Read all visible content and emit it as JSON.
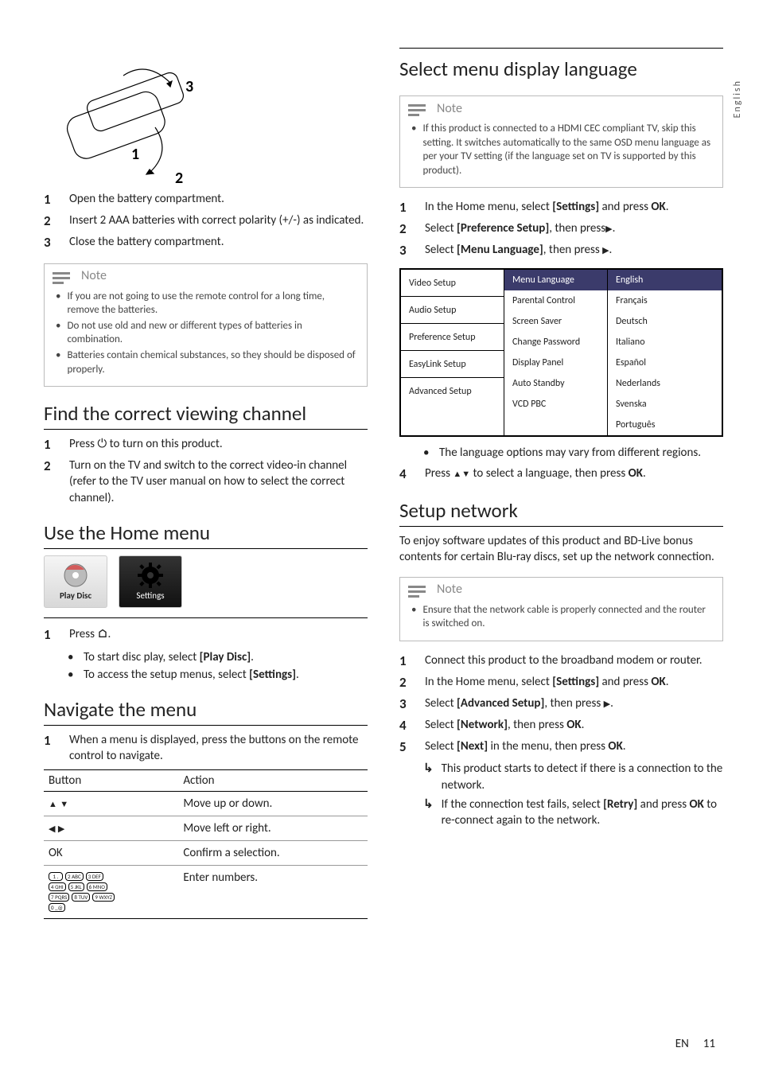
{
  "sideTab": "English",
  "left": {
    "remoteSteps": [
      "Open the battery compartment.",
      "Insert 2 AAA batteries with correct polarity (+/-) as indicated.",
      "Close the battery compartment."
    ],
    "note1Title": "Note",
    "note1Items": [
      "If you are not going to use the remote control for a long time, remove the batteries.",
      "Do not use old and new or different types of batteries in combination.",
      "Batteries contain chemical substances, so they should be disposed of properly."
    ],
    "h_find": "Find the correct viewing channel",
    "findSteps": [
      {
        "pre": "Press ",
        "glyph": "power",
        "post": " to turn on this product."
      },
      {
        "text": "Turn on the TV and switch to the correct video-in channel (refer to the TV user manual on how to select the correct channel)."
      }
    ],
    "h_home": "Use the Home menu",
    "homeIcons": {
      "play": "Play Disc",
      "settings": "Settings"
    },
    "homeStep": {
      "pre": "Press ",
      "glyph": "home",
      "post": "."
    },
    "homeBullets": [
      {
        "pre": "To start disc play, select ",
        "bold": "[Play Disc]",
        "post": "."
      },
      {
        "pre": "To access the setup menus, select ",
        "bold": "[Settings]",
        "post": "."
      }
    ],
    "h_nav": "Navigate the menu",
    "navStep": "When a menu is displayed, press the buttons on the remote control to navigate.",
    "navTable": {
      "hButton": "Button",
      "hAction": "Action",
      "rows": [
        {
          "btn": "updown",
          "action": "Move up or down."
        },
        {
          "btn": "leftright",
          "action": "Move left or right."
        },
        {
          "btn": "OK",
          "action": "Confirm a selection."
        },
        {
          "btn": "keypad",
          "action": "Enter numbers."
        }
      ],
      "keypad": [
        [
          "1 .",
          "2 ABC",
          "3 DEF"
        ],
        [
          "4 GHI",
          "5 JKL",
          "6 MNO"
        ],
        [
          "7 PQRS",
          "8 TUV",
          "9 WXYZ"
        ],
        [
          "0 _@"
        ]
      ]
    }
  },
  "right": {
    "h_lang": "Select menu display language",
    "note2Title": "Note",
    "note2Items": [
      "If this product is connected to a HDMI CEC compliant TV, skip this setting. It switches automatically to the same OSD menu language as per your TV setting (if the language set on TV is supported by this product)."
    ],
    "langSteps": [
      {
        "pre": "In the Home menu, select ",
        "bold": "[Settings]",
        "mid": " and press ",
        "bold2": "OK",
        "post": "."
      },
      {
        "pre": "Select ",
        "bold": "[Preference Setup]",
        "mid": ", then press",
        "arrow": true,
        "post": "."
      },
      {
        "pre": "Select ",
        "bold": "[Menu Language]",
        "mid": ", then press ",
        "arrow": true,
        "post": "."
      }
    ],
    "menu": {
      "left": [
        "Video Setup",
        "Audio Setup",
        "Preference Setup",
        "EasyLink Setup",
        "Advanced Setup"
      ],
      "mid": [
        "Menu Language",
        "Parental Control",
        "Screen Saver",
        "Change Password",
        "Display Panel",
        "Auto Standby",
        "VCD PBC"
      ],
      "right": [
        "English",
        "Français",
        "Deutsch",
        "Italiano",
        "Español",
        "Nederlands",
        "Svenska",
        "Português"
      ]
    },
    "langNote": "The language options may vary from different regions.",
    "langStep4": {
      "num": "4",
      "pre": "Press ",
      "glyph": "updown",
      "mid": " to select a language, then press ",
      "bold": "OK",
      "post": "."
    },
    "h_net": "Setup network",
    "netIntro": "To enjoy software updates of this product and BD-Live bonus contents for certain Blu-ray discs, set up the network connection.",
    "note3Title": "Note",
    "note3Items": [
      "Ensure that the network cable is properly connected and the router is switched on."
    ],
    "netSteps": [
      {
        "text": "Connect this product to the broadband modem or router."
      },
      {
        "pre": "In the Home menu, select ",
        "bold": "[Settings]",
        "mid": " and press ",
        "bold2": "OK",
        "post": "."
      },
      {
        "pre": "Select ",
        "bold": "[Advanced Setup]",
        "mid": ", then press ",
        "arrow": true,
        "post": "."
      },
      {
        "pre": "Select ",
        "bold": "[Network]",
        "mid": ", then press ",
        "bold2": "OK",
        "post": "."
      },
      {
        "pre": "Select ",
        "bold": "[Next]",
        "mid": " in the menu, then press ",
        "bold2": "OK",
        "post": "."
      }
    ],
    "netArrows": [
      "This product starts to detect if there is a connection to the network.",
      {
        "pre": "If the connection test fails, select ",
        "bold": "[Retry]",
        "mid": " and press ",
        "bold2": "OK",
        "post": " to re-connect again to the network."
      }
    ]
  },
  "footer": {
    "lang": "EN",
    "page": "11"
  }
}
